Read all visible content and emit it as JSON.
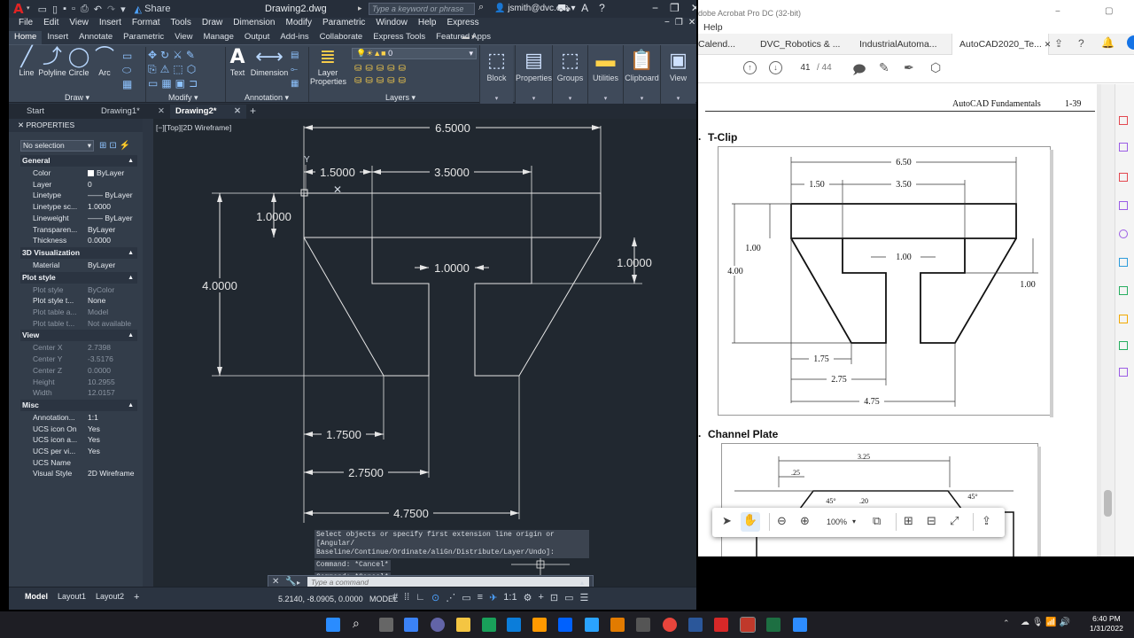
{
  "acad": {
    "title": "Drawing2.dwg",
    "share": "Share",
    "search_placeholder": "Type a keyword or phrase",
    "user": "jsmith@dvc.e...",
    "menu": [
      "File",
      "Edit",
      "View",
      "Insert",
      "Format",
      "Tools",
      "Draw",
      "Dimension",
      "Modify",
      "Parametric",
      "Window",
      "Help",
      "Express"
    ],
    "ribbon_tabs": [
      "Home",
      "Insert",
      "Annotate",
      "Parametric",
      "View",
      "Manage",
      "Output",
      "Add-ins",
      "Collaborate",
      "Express Tools",
      "Featured Apps"
    ],
    "ribbon_active": "Home",
    "draw_tools": [
      "Line",
      "Polyline",
      "Circle",
      "Arc"
    ],
    "tools": {
      "text": "Text",
      "dimension": "Dimension",
      "layer_props": "Layer Properties",
      "block": "Block",
      "properties": "Properties",
      "groups": "Groups",
      "utilities": "Utilities",
      "clipboard": "Clipboard",
      "view": "View"
    },
    "panels": {
      "draw": "Draw",
      "modify": "Modify",
      "annotation": "Annotation",
      "layers": "Layers"
    },
    "layer_value": "0",
    "file_tabs": [
      {
        "label": "Start",
        "active": false
      },
      {
        "label": "Drawing1*",
        "active": false
      },
      {
        "label": "Drawing2*",
        "active": true
      }
    ],
    "view_label": "[−][Top][2D Wireframe]",
    "properties": {
      "title": "PROPERTIES",
      "selection": "No selection",
      "groups": [
        {
          "name": "General",
          "rows": [
            {
              "k": "Color",
              "v": "ByLayer",
              "swatch": true
            },
            {
              "k": "Layer",
              "v": "0"
            },
            {
              "k": "Linetype",
              "v": "—— ByLayer"
            },
            {
              "k": "Linetype sc...",
              "v": "1.0000"
            },
            {
              "k": "Lineweight",
              "v": "—— ByLayer"
            },
            {
              "k": "Transparen...",
              "v": "ByLayer"
            },
            {
              "k": "Thickness",
              "v": "0.0000"
            }
          ]
        },
        {
          "name": "3D Visualization",
          "rows": [
            {
              "k": "Material",
              "v": "ByLayer"
            }
          ]
        },
        {
          "name": "Plot style",
          "rows": [
            {
              "k": "Plot style",
              "v": "ByColor",
              "dim": true
            },
            {
              "k": "Plot style t...",
              "v": "None"
            },
            {
              "k": "Plot table a...",
              "v": "Model",
              "dim": true
            },
            {
              "k": "Plot table t...",
              "v": "Not available",
              "dim": true
            }
          ]
        },
        {
          "name": "View",
          "rows": [
            {
              "k": "Center X",
              "v": "2.7398",
              "dim": true
            },
            {
              "k": "Center Y",
              "v": "-3.5176",
              "dim": true
            },
            {
              "k": "Center Z",
              "v": "0.0000",
              "dim": true
            },
            {
              "k": "Height",
              "v": "10.2955",
              "dim": true
            },
            {
              "k": "Width",
              "v": "12.0157",
              "dim": true
            }
          ]
        },
        {
          "name": "Misc",
          "rows": [
            {
              "k": "Annotation...",
              "v": "1:1"
            },
            {
              "k": "UCS icon On",
              "v": "Yes"
            },
            {
              "k": "UCS icon a...",
              "v": "Yes"
            },
            {
              "k": "UCS per vi...",
              "v": "Yes"
            },
            {
              "k": "UCS Name",
              "v": ""
            },
            {
              "k": "Visual Style",
              "v": "2D Wireframe"
            }
          ]
        }
      ]
    },
    "dimensions": {
      "total_width": "6.5000",
      "left_top": "1.5000",
      "top_slot": "3.5000",
      "left_drop": "1.0000",
      "height": "4.0000",
      "stem_gap": "1.0000",
      "right_drop": "1.0000",
      "bottom_left": "1.7500",
      "bottom_mid": "2.7500",
      "bottom_total": "4.7500"
    },
    "axis_y": "Y",
    "command_history": [
      "Select objects or specify first extension line origin or [Angular/ Baseline/Continue/Ordinate/aliGn/Distribute/Layer/Undo]:",
      "Command: *Cancel*",
      "Command: *Cancel*"
    ],
    "command_placeholder": "Type a command",
    "layout_tabs": [
      "Model",
      "Layout1",
      "Layout2"
    ],
    "coords": "5.2140, -8.0905, 0.0000",
    "model_label": "MODEL",
    "scale": "1:1"
  },
  "acrobat": {
    "title": "dobe Acrobat Pro DC (32-bit)",
    "help": "Help",
    "tabs": [
      "Calend...",
      "DVC_Robotics & ...",
      "IndustrialAutoma...",
      "AutoCAD2020_Te..."
    ],
    "page_current": "41",
    "page_total": "/ 44",
    "zoom": "100%",
    "header_title": "AutoCAD Fundamentals",
    "header_page": "1-39",
    "section1": "T-Clip",
    "section2": "Channel Plate",
    "tclip_dims": {
      "total": "6.50",
      "left": "1.50",
      "slot": "3.50",
      "left_drop": "1.00",
      "height": "4.00",
      "gap": "1.00",
      "right_drop": "1.00",
      "b1": "1.75",
      "b2": "2.75",
      "b3": "4.75"
    },
    "channel_dims": {
      "top": "3.25",
      "a": ".25",
      "ang1": "45°",
      "mid": ".20",
      "ang2": "45°"
    },
    "bullet1": ".",
    "bullet2": "."
  },
  "taskbar": {
    "time": "6:40 PM",
    "date": "1/31/2022"
  },
  "colors": {
    "acad_bg": "#212830",
    "acad_chrome": "#2b3441",
    "ribbon": "#3b4655",
    "accent": "#4da3ff",
    "cad_line": "#e6e6e6"
  }
}
